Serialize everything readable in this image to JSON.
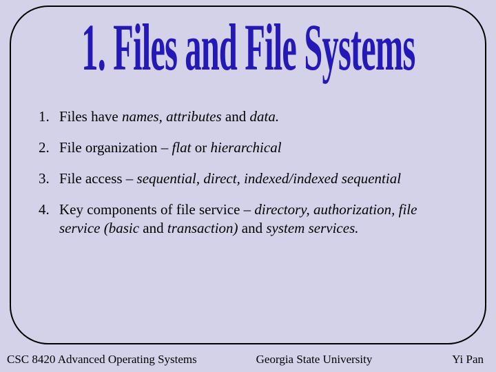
{
  "title": "1. Files and File Systems",
  "items": [
    {
      "n": "1.",
      "html": "Files have <i>names, attributes</i> and <i>data.</i>"
    },
    {
      "n": "2.",
      "html": "File organization – <i>flat</i> or <i>hierarchical</i>"
    },
    {
      "n": "3.",
      "html": "File access – <i>sequential, direct, indexed/indexed sequential</i>"
    },
    {
      "n": "4.",
      "html": "Key components of file service – <i>directory, authorization, file service (basic</i> and <i>transaction)</i> and <i>system services.</i>"
    }
  ],
  "footer": {
    "left": "CSC 8420 Advanced Operating Systems",
    "center": "Georgia State University",
    "right": "Yi Pan"
  }
}
